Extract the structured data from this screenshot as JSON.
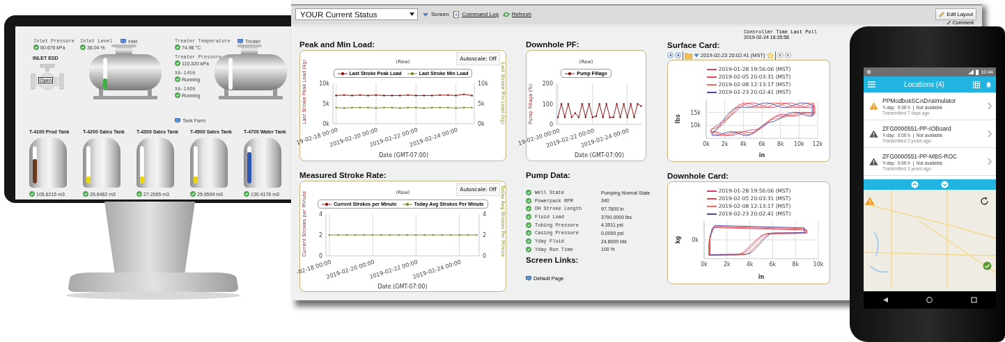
{
  "monitor": {
    "readings": [
      {
        "label": "Inlet Pressure",
        "value": "60.676 kPa"
      },
      {
        "label": "Inlet Level",
        "value": "36.04 %"
      },
      {
        "label": "Treater Temperature",
        "value": "74.98 °C"
      },
      {
        "label": "Treater Pressure",
        "value": "110.320 kPa"
      },
      {
        "label": "XA-1450",
        "value": "Running"
      },
      {
        "label": "XA-1460",
        "value": "Running"
      }
    ],
    "screen_links": [
      "Inlet",
      "Treater",
      "Tank Farm"
    ],
    "valve": {
      "title": "INLET ESD",
      "state": "Open"
    },
    "vessels": [
      {
        "level": 0.35
      },
      {
        "level": 0
      }
    ],
    "tanks": [
      {
        "name": "T-4100 Prod Tank",
        "level": 0.65,
        "color": "#6b3a1e",
        "reading": "105.6215 m3"
      },
      {
        "name": "T-4200 Sales Tank",
        "level": 0.18,
        "color": "#e8d800",
        "reading": "26.6482 m3"
      },
      {
        "name": "T-4300 Sales Tank",
        "level": 0.18,
        "color": "#e8d800",
        "reading": "27.2065 m3"
      },
      {
        "name": "T-4500 Sales Tank",
        "level": 0.18,
        "color": "#e8d800",
        "reading": "25.9599 m3"
      },
      {
        "name": "T-4700 Water Tank",
        "level": 0.83,
        "color": "#2f56b0",
        "reading": "130.4176 m3"
      }
    ]
  },
  "toolbar": {
    "screen_select": "YOUR Current Status",
    "screen_button": "Screen",
    "links": [
      "Command Log",
      "Refresh"
    ],
    "edit_layout": "Edit Layout",
    "comment": "Comment"
  },
  "controller_time": {
    "label": "Controller Time Last Poll",
    "value": "2019-02-24 16:35:58"
  },
  "peak_min_load": {
    "title": "Peak and Min Load:",
    "autoscale": "Autoscale: Off",
    "chart_data": {
      "type": "line",
      "title": "(Raw)",
      "xlabel": "Date (GMT-07:00)",
      "ylabel": "Last Stroke Peak Load (kg)",
      "y2label": "Last Stroke Min Load (kg)",
      "grid": true,
      "legend": "top",
      "categories": [
        "19-02-18 00:00",
        null,
        null,
        null,
        null,
        "2019-02-20 00:00",
        null,
        null,
        null,
        null,
        "2019-02-22 00:00",
        null,
        null,
        null,
        null,
        "2019-02-24 00:00",
        null,
        null
      ],
      "series": [
        {
          "name": "Last Stroke Peak Load",
          "color": "#8b1a1a",
          "values": [
            7000,
            7100,
            7000,
            7100,
            7000,
            7100,
            7000,
            7000,
            7000,
            7100,
            7000,
            7000,
            7000,
            7100,
            7100,
            7000,
            7300,
            7000
          ]
        },
        {
          "name": "Last Stroke Min Load",
          "color": "#7f8a2a",
          "values": [
            4000,
            3900,
            4000,
            4000,
            4000,
            3900,
            4000,
            4000,
            3900,
            4000,
            4000,
            3900,
            4000,
            4000,
            4000,
            3900,
            4000,
            4000
          ]
        }
      ],
      "ylim": [
        0,
        10000
      ],
      "yticks": [
        {
          "value": 0,
          "label": "0k"
        },
        {
          "value": 5000,
          "label": "5k"
        },
        {
          "value": 10000,
          "label": "10k"
        }
      ]
    }
  },
  "downhole_pf": {
    "title": "Downhole PF:",
    "chart_data": {
      "type": "line",
      "title": "(Raw)",
      "xlabel": "Date (GMT-07:00)",
      "ylabel": "Pump Fillage (%)",
      "grid": true,
      "legend": "top",
      "categories": [
        "19-02-20 00:00",
        null,
        null,
        null,
        null,
        null,
        null,
        null,
        null,
        null,
        "2019-02-22 00:00",
        null,
        null,
        null,
        null,
        null,
        null,
        null,
        null,
        null,
        "2019-02-24 00:00",
        null,
        null,
        null,
        null
      ],
      "series": [
        {
          "name": "Pump Fillage",
          "color": "#8b1a1a",
          "values": [
            35,
            100,
            35,
            100,
            35,
            55,
            35,
            100,
            35,
            100,
            35,
            40,
            100,
            35,
            100,
            35,
            35,
            100,
            35,
            100,
            35,
            100,
            35,
            100,
            90
          ]
        }
      ],
      "ylim": [
        0,
        200
      ],
      "yticks": [
        {
          "value": 0,
          "label": "0"
        },
        {
          "value": 100,
          "label": "100"
        },
        {
          "value": 200,
          "label": "200"
        }
      ]
    }
  },
  "stroke_rate": {
    "title": "Measured Stroke Rate:",
    "autoscale": "Autoscale: Off",
    "chart_data": {
      "type": "line",
      "title": "(Raw)",
      "xlabel": "Date (GMT-07:00)",
      "ylabel": "Current Strokes per Minute",
      "y2label": "Today Avg Strokes Per Minute",
      "grid": true,
      "legend": "top",
      "categories": [
        "-02-18 00:00",
        null,
        null,
        null,
        null,
        "2019-02-20 00:00",
        null,
        null,
        null,
        null,
        "2019-02-22 00:00",
        null,
        null,
        null,
        null,
        "2019-02-24 00:00",
        null,
        null
      ],
      "series": [
        {
          "name": "Current Strokes per Minute",
          "color": "#8b1a1a",
          "values": [
            null,
            null,
            null,
            null,
            null,
            null,
            null,
            null,
            null,
            null,
            null,
            null,
            null,
            null,
            null,
            null,
            null,
            null
          ]
        },
        {
          "name": "Today Avg Strokes Per Minute",
          "color": "#7f8a2a",
          "values": [
            2,
            2,
            2,
            2,
            2,
            2,
            2,
            2,
            2,
            2,
            2,
            2,
            2,
            2,
            2,
            2,
            2,
            2
          ]
        }
      ],
      "ylim": [
        0,
        4
      ],
      "yticks": [
        {
          "value": 0,
          "label": "0"
        },
        {
          "value": 2,
          "label": "2"
        },
        {
          "value": 4,
          "label": "4"
        }
      ]
    }
  },
  "pump_data": {
    "title": "Pump Data:",
    "rows": [
      {
        "label": "Well State",
        "value": "Pumping Normal State"
      },
      {
        "label": "Powerpack RPM",
        "value": "340"
      },
      {
        "label": "DH Stroke Length",
        "value": "97.7600 in"
      },
      {
        "label": "Fluid Load",
        "value": "3790.0000 lbs"
      },
      {
        "label": "Tubing Pressure",
        "value": "4.3511 psi"
      },
      {
        "label": "Casing Pressure",
        "value": "0.0000 psi"
      },
      {
        "label": "Yday Fluid",
        "value": "24.8000 bbl"
      },
      {
        "label": "Yday Run Time",
        "value": "100 %"
      }
    ]
  },
  "screen_links": {
    "title": "Screen Links:",
    "links": [
      "Default Page"
    ]
  },
  "surface_card": {
    "title": "Surface Card:",
    "selected_card": "2019-02-23 20:02:41 (MST)",
    "kind": "surface",
    "legend": [
      {
        "label": "2019-01-28 19:56:06 (MST)",
        "color": "#d0406a"
      },
      {
        "label": "2019-02-05 20:03:31 (MST)",
        "color": "#e8464c"
      },
      {
        "label": "2019-02-08 12:13:17 (MST)",
        "color": "#f26a5a"
      },
      {
        "label": "2019-02-23 20:02:41 (MST)",
        "color": "#3f48a8"
      }
    ],
    "x_labels": [
      "0k",
      "2k",
      "4k",
      "6k",
      "8k",
      "10k",
      "12k"
    ],
    "y_labels": [
      "15k",
      "10k"
    ],
    "x_title": "in",
    "y_title": "lbs"
  },
  "downhole_card": {
    "title": "Downhole Card:",
    "kind": "downhole",
    "legend": [
      {
        "label": "2019-01-28 19:56:06 (MST)",
        "color": "#d0406a"
      },
      {
        "label": "2019-02-05 20:03:31 (MST)",
        "color": "#e8464c"
      },
      {
        "label": "2019-02-08 12:13:17 (MST)",
        "color": "#f26a5a"
      },
      {
        "label": "2019-02-23 20:02:41 (MST)",
        "color": "#3f48a8"
      }
    ],
    "x_labels": [
      "0k",
      "2k",
      "4k",
      "6k",
      "8k",
      "10k"
    ],
    "y_labels": [
      "0k"
    ],
    "x_title": "in",
    "y_title": "kg"
  },
  "phone": {
    "time": "10:44",
    "title": "Locations (4)",
    "locations": [
      {
        "name": "PPModbusSCADAsimulator",
        "detail": "Y-day:  0:00 h  |  Not available",
        "transmitted": "Transmitted 7 days ago",
        "color": "#f39a1e"
      },
      {
        "name": "ZFG0000551-PP-IOBoard",
        "detail": "Y-day:  0:00 h  |  Not available",
        "transmitted": "Transmitted 3 years ago",
        "color": "#555555"
      },
      {
        "name": "ZFG0000551-PP-MBS-ROC",
        "detail": "Y-day:  0:00 h  |  Not available",
        "transmitted": "Transmitted 3 years ago",
        "color": "#555555"
      }
    ]
  }
}
